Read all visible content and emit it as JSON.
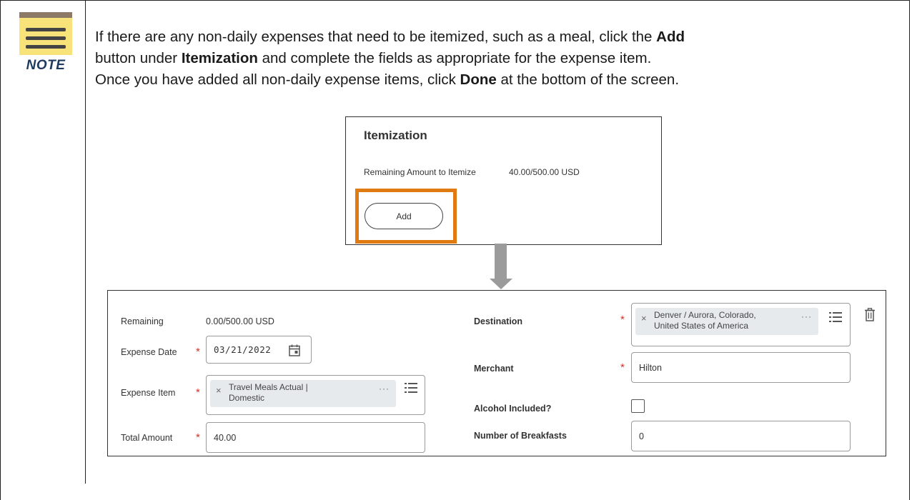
{
  "note": {
    "icon": "note-icon",
    "label": "NOTE",
    "line1_pre": "If there are any non-daily expenses that need to be itemized, such as a meal, click the ",
    "line1_bold": "Add",
    "line2_pre": "button under ",
    "line2_bold": "Itemization",
    "line2_post": " and complete the fields as appropriate for the expense item.",
    "line3_pre": "Once you have added all non-daily expense items, click ",
    "line3_bold": "Done",
    "line3_post": " at the bottom of the screen."
  },
  "itemization": {
    "title": "Itemization",
    "remaining_label": "Remaining Amount to Itemize",
    "remaining_value": "40.00/500.00 USD",
    "add_label": "Add",
    "highlight_color": "#e07b14"
  },
  "expense_form": {
    "remaining_label": "Remaining",
    "remaining_value": "0.00/500.00 USD",
    "expense_date_label": "Expense Date",
    "expense_date_value": "03/21/2022",
    "expense_item_label": "Expense Item",
    "expense_item_line1": "Travel Meals Actual |",
    "expense_item_line2": "Domestic",
    "total_amount_label": "Total Amount",
    "total_amount_value": "40.00",
    "destination_label": "Destination",
    "destination_line1": "Denver / Aurora, Colorado,",
    "destination_line2": "United States of America",
    "merchant_label": "Merchant",
    "merchant_value": "Hilton",
    "alcohol_label": "Alcohol Included?",
    "breakfasts_label": "Number of Breakfasts",
    "breakfasts_value": "0",
    "required_mark": "*",
    "pill_remove": "×",
    "pill_more": "···"
  },
  "colors": {
    "required": "#d93025",
    "note_pad": "#f8e27a",
    "note_label": "#1e3a5f",
    "arrow": "#9b9b9b"
  }
}
